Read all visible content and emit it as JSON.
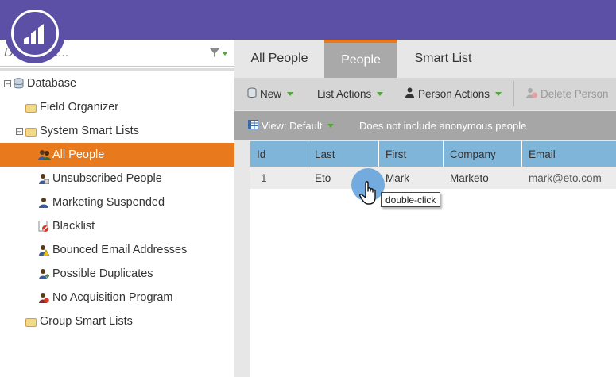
{
  "search": {
    "placeholder": "Database..."
  },
  "tree": [
    {
      "label": "Database",
      "icon": "database-icon",
      "level": 0,
      "expanded": true
    },
    {
      "label": "Field Organizer",
      "icon": "folder-icon",
      "level": 1
    },
    {
      "label": "System Smart Lists",
      "icon": "folder-icon",
      "level": 1,
      "expanded": true
    },
    {
      "label": "All People",
      "icon": "people-icon",
      "level": 2,
      "selected": true
    },
    {
      "label": "Unsubscribed People",
      "icon": "person-unsubscribed-icon",
      "level": 2
    },
    {
      "label": "Marketing Suspended",
      "icon": "person-suspended-icon",
      "level": 2
    },
    {
      "label": "Blacklist",
      "icon": "blacklist-icon",
      "level": 2
    },
    {
      "label": "Bounced Email Addresses",
      "icon": "person-warning-icon",
      "level": 2
    },
    {
      "label": "Possible Duplicates",
      "icon": "person-add-icon",
      "level": 2
    },
    {
      "label": "No Acquisition Program",
      "icon": "person-no-program-icon",
      "level": 2
    },
    {
      "label": "Group Smart Lists",
      "icon": "folder-icon",
      "level": 1
    }
  ],
  "tabs": [
    {
      "label": "All People",
      "active": false
    },
    {
      "label": "People",
      "active": true
    },
    {
      "label": "Smart List",
      "active": false
    }
  ],
  "toolbar": {
    "new_label": "New",
    "list_actions_label": "List Actions",
    "person_actions_label": "Person Actions",
    "delete_person_label": "Delete Person"
  },
  "viewbar": {
    "view_label": "View: Default",
    "note": "Does not include anonymous people"
  },
  "table": {
    "columns": [
      "Id",
      "Last",
      "First",
      "Company",
      "Email"
    ],
    "rows": [
      {
        "id": "1",
        "last": "Eto",
        "first": "Mark",
        "company": "Marketo",
        "email": "mark@eto.com"
      }
    ]
  },
  "tooltip": "double-click",
  "colors": {
    "brand": "#5b4fa6",
    "accent": "#e8791d",
    "header": "#7fb5d8"
  }
}
